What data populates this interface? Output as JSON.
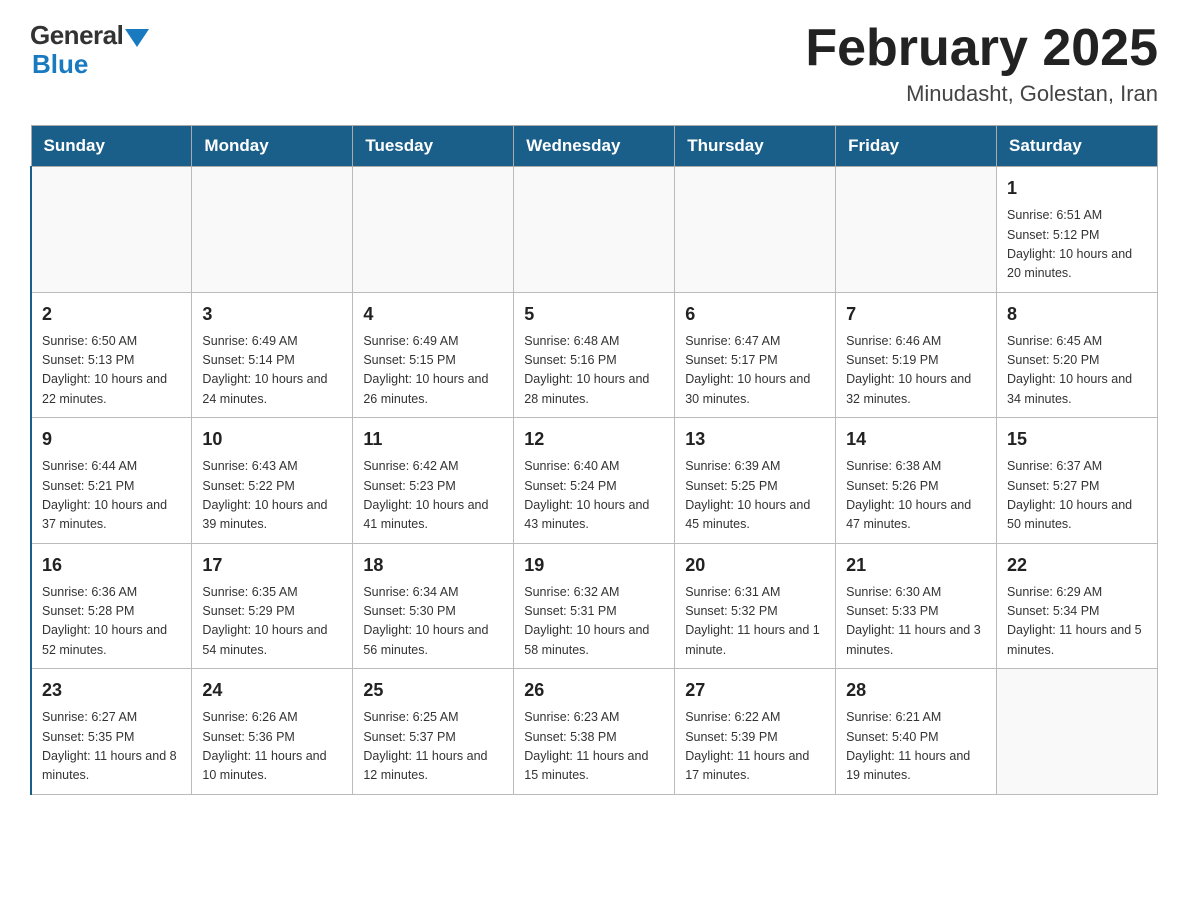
{
  "header": {
    "logo_general": "General",
    "logo_blue": "Blue",
    "month_title": "February 2025",
    "location": "Minudasht, Golestan, Iran"
  },
  "days_of_week": [
    "Sunday",
    "Monday",
    "Tuesday",
    "Wednesday",
    "Thursday",
    "Friday",
    "Saturday"
  ],
  "weeks": [
    [
      {
        "day": "",
        "info": ""
      },
      {
        "day": "",
        "info": ""
      },
      {
        "day": "",
        "info": ""
      },
      {
        "day": "",
        "info": ""
      },
      {
        "day": "",
        "info": ""
      },
      {
        "day": "",
        "info": ""
      },
      {
        "day": "1",
        "info": "Sunrise: 6:51 AM\nSunset: 5:12 PM\nDaylight: 10 hours and 20 minutes."
      }
    ],
    [
      {
        "day": "2",
        "info": "Sunrise: 6:50 AM\nSunset: 5:13 PM\nDaylight: 10 hours and 22 minutes."
      },
      {
        "day": "3",
        "info": "Sunrise: 6:49 AM\nSunset: 5:14 PM\nDaylight: 10 hours and 24 minutes."
      },
      {
        "day": "4",
        "info": "Sunrise: 6:49 AM\nSunset: 5:15 PM\nDaylight: 10 hours and 26 minutes."
      },
      {
        "day": "5",
        "info": "Sunrise: 6:48 AM\nSunset: 5:16 PM\nDaylight: 10 hours and 28 minutes."
      },
      {
        "day": "6",
        "info": "Sunrise: 6:47 AM\nSunset: 5:17 PM\nDaylight: 10 hours and 30 minutes."
      },
      {
        "day": "7",
        "info": "Sunrise: 6:46 AM\nSunset: 5:19 PM\nDaylight: 10 hours and 32 minutes."
      },
      {
        "day": "8",
        "info": "Sunrise: 6:45 AM\nSunset: 5:20 PM\nDaylight: 10 hours and 34 minutes."
      }
    ],
    [
      {
        "day": "9",
        "info": "Sunrise: 6:44 AM\nSunset: 5:21 PM\nDaylight: 10 hours and 37 minutes."
      },
      {
        "day": "10",
        "info": "Sunrise: 6:43 AM\nSunset: 5:22 PM\nDaylight: 10 hours and 39 minutes."
      },
      {
        "day": "11",
        "info": "Sunrise: 6:42 AM\nSunset: 5:23 PM\nDaylight: 10 hours and 41 minutes."
      },
      {
        "day": "12",
        "info": "Sunrise: 6:40 AM\nSunset: 5:24 PM\nDaylight: 10 hours and 43 minutes."
      },
      {
        "day": "13",
        "info": "Sunrise: 6:39 AM\nSunset: 5:25 PM\nDaylight: 10 hours and 45 minutes."
      },
      {
        "day": "14",
        "info": "Sunrise: 6:38 AM\nSunset: 5:26 PM\nDaylight: 10 hours and 47 minutes."
      },
      {
        "day": "15",
        "info": "Sunrise: 6:37 AM\nSunset: 5:27 PM\nDaylight: 10 hours and 50 minutes."
      }
    ],
    [
      {
        "day": "16",
        "info": "Sunrise: 6:36 AM\nSunset: 5:28 PM\nDaylight: 10 hours and 52 minutes."
      },
      {
        "day": "17",
        "info": "Sunrise: 6:35 AM\nSunset: 5:29 PM\nDaylight: 10 hours and 54 minutes."
      },
      {
        "day": "18",
        "info": "Sunrise: 6:34 AM\nSunset: 5:30 PM\nDaylight: 10 hours and 56 minutes."
      },
      {
        "day": "19",
        "info": "Sunrise: 6:32 AM\nSunset: 5:31 PM\nDaylight: 10 hours and 58 minutes."
      },
      {
        "day": "20",
        "info": "Sunrise: 6:31 AM\nSunset: 5:32 PM\nDaylight: 11 hours and 1 minute."
      },
      {
        "day": "21",
        "info": "Sunrise: 6:30 AM\nSunset: 5:33 PM\nDaylight: 11 hours and 3 minutes."
      },
      {
        "day": "22",
        "info": "Sunrise: 6:29 AM\nSunset: 5:34 PM\nDaylight: 11 hours and 5 minutes."
      }
    ],
    [
      {
        "day": "23",
        "info": "Sunrise: 6:27 AM\nSunset: 5:35 PM\nDaylight: 11 hours and 8 minutes."
      },
      {
        "day": "24",
        "info": "Sunrise: 6:26 AM\nSunset: 5:36 PM\nDaylight: 11 hours and 10 minutes."
      },
      {
        "day": "25",
        "info": "Sunrise: 6:25 AM\nSunset: 5:37 PM\nDaylight: 11 hours and 12 minutes."
      },
      {
        "day": "26",
        "info": "Sunrise: 6:23 AM\nSunset: 5:38 PM\nDaylight: 11 hours and 15 minutes."
      },
      {
        "day": "27",
        "info": "Sunrise: 6:22 AM\nSunset: 5:39 PM\nDaylight: 11 hours and 17 minutes."
      },
      {
        "day": "28",
        "info": "Sunrise: 6:21 AM\nSunset: 5:40 PM\nDaylight: 11 hours and 19 minutes."
      },
      {
        "day": "",
        "info": ""
      }
    ]
  ]
}
